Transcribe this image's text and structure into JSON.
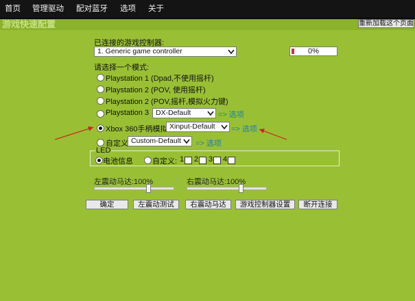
{
  "menubar": {
    "items": [
      "首页",
      "管理驱动",
      "配对蓝牙",
      "选项",
      "关于"
    ]
  },
  "header": {
    "title": "游戏快速配置",
    "reload_label": "重新加载这个页面"
  },
  "controller": {
    "label": "已连接的游戏控制器:",
    "selected": "1. Generic game controller",
    "battery_percent": "0%",
    "battery_fraction": 0.06
  },
  "mode": {
    "label": "请选择一个模式:",
    "options": [
      {
        "label": "Playstation 1 (Dpad,不使用摇杆)"
      },
      {
        "label": "Playstation 2 (POV, 使用摇杆)"
      },
      {
        "label": "Playstation 2 (POV,摇杆,模拟火力键)"
      },
      {
        "label": "Playstation 3",
        "select": "DX-Default",
        "link": "=> 选项"
      },
      {
        "label": "Xbox 360手柄模拟",
        "select": "Xinput-Default",
        "link": "=> 选项",
        "selected": true
      },
      {
        "label": "自定义",
        "select": "Custom-Default",
        "link": "=> 选项"
      }
    ]
  },
  "led": {
    "legend": "LED",
    "battery_option": "电池信息",
    "custom_option": "自定义:",
    "checks": [
      "1",
      "2",
      "3",
      "4"
    ]
  },
  "rumble": {
    "left_label": "左震动马达:100%",
    "right_label": "右震动马达:100%",
    "left_value": 1.0,
    "right_value": 1.0
  },
  "buttons": {
    "ok": "确定",
    "left_test": "左震动测试",
    "right_test": "右震动马达",
    "controller_settings": "游戏控制器设置",
    "disconnect": "断开连接"
  },
  "colors": {
    "panel": "#99c034",
    "link": "#1e7ea8",
    "annotation": "#d42020"
  }
}
